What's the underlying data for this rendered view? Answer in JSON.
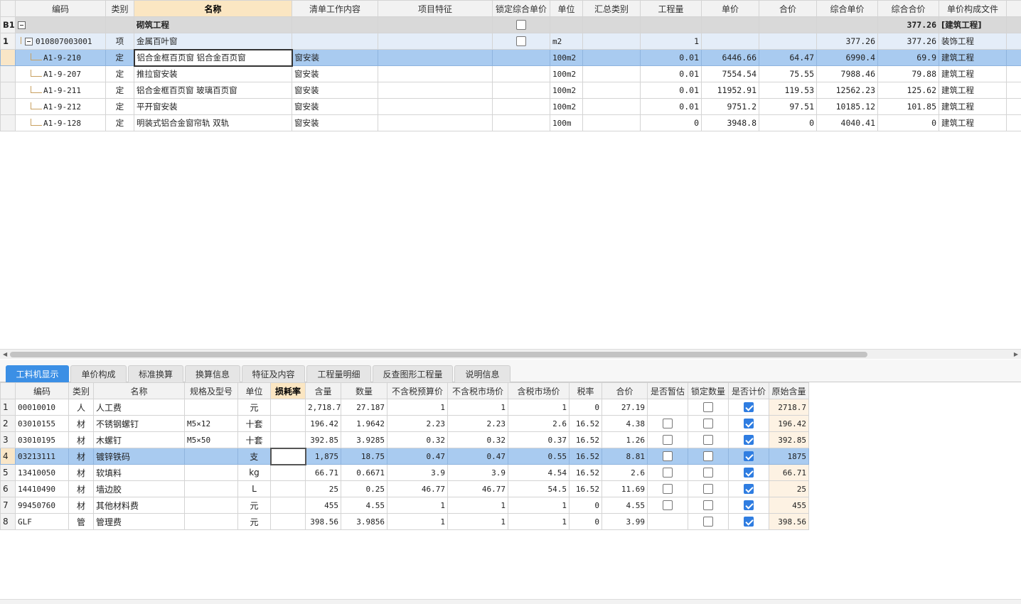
{
  "top": {
    "headers": [
      "",
      "编码",
      "类别",
      "名称",
      "清单工作内容",
      "项目特征",
      "锁定综合单价",
      "单位",
      "汇总类别",
      "工程量",
      "单价",
      "合价",
      "综合单价",
      "综合合价",
      "单价构成文件"
    ],
    "group": {
      "rn": "B1",
      "name": "砌筑工程",
      "total": "377.26",
      "file": "[建筑工程]"
    },
    "item": {
      "rn": "1",
      "code": "010807003001",
      "type": "项",
      "name": "金属百叶窗",
      "unit": "m2",
      "qty": "1",
      "comp_price": "377.26",
      "comp_total": "377.26",
      "file": "装饰工程"
    },
    "rows": [
      {
        "code": "A1-9-210",
        "type": "定",
        "name": "铝合金框百页窗 铝合金百页窗",
        "work": "窗安装",
        "unit": "100m2",
        "qty": "0.01",
        "price": "6446.66",
        "total": "64.47",
        "comp_price": "6990.4",
        "comp_total": "69.9",
        "file": "建筑工程"
      },
      {
        "code": "A1-9-207",
        "type": "定",
        "name": "推拉窗安装",
        "work": "窗安装",
        "unit": "100m2",
        "qty": "0.01",
        "price": "7554.54",
        "total": "75.55",
        "comp_price": "7988.46",
        "comp_total": "79.88",
        "file": "建筑工程"
      },
      {
        "code": "A1-9-211",
        "type": "定",
        "name": "铝合金框百页窗 玻璃百页窗",
        "work": "窗安装",
        "unit": "100m2",
        "qty": "0.01",
        "price": "11952.91",
        "total": "119.53",
        "comp_price": "12562.23",
        "comp_total": "125.62",
        "file": "建筑工程"
      },
      {
        "code": "A1-9-212",
        "type": "定",
        "name": "平开窗安装",
        "work": "窗安装",
        "unit": "100m2",
        "qty": "0.01",
        "price": "9751.2",
        "total": "97.51",
        "comp_price": "10185.12",
        "comp_total": "101.85",
        "file": "建筑工程"
      },
      {
        "code": "A1-9-128",
        "type": "定",
        "name": "明装式铝合金窗帘轨 双轨",
        "work": "窗安装",
        "unit": "100m",
        "qty": "0",
        "price": "3948.8",
        "total": "0",
        "comp_price": "4040.41",
        "comp_total": "0",
        "file": "建筑工程"
      }
    ]
  },
  "tabs": [
    "工料机显示",
    "单价构成",
    "标准换算",
    "换算信息",
    "特征及内容",
    "工程量明细",
    "反查图形工程量",
    "说明信息"
  ],
  "bottom": {
    "headers": [
      "",
      "编码",
      "类别",
      "名称",
      "规格及型号",
      "单位",
      "损耗率",
      "含量",
      "数量",
      "不含税预算价",
      "不含税市场价",
      "含税市场价",
      "税率",
      "合价",
      "是否暂估",
      "锁定数量",
      "是否计价",
      "原始含量"
    ],
    "rows": [
      {
        "rn": "1",
        "code": "00010010",
        "type": "人",
        "name": "人工费",
        "spec": "",
        "unit": "元",
        "content": "2,718.7",
        "qty": "27.187",
        "budget": "1",
        "market": "1",
        "market_tax": "1",
        "tax": "0",
        "total": "27.19",
        "est": null,
        "lock": false,
        "priced": true,
        "orig": "2718.7"
      },
      {
        "rn": "2",
        "code": "03010155",
        "type": "材",
        "name": "不锈钢螺钉",
        "spec": "M5×12",
        "unit": "十套",
        "content": "196.42",
        "qty": "1.9642",
        "budget": "2.23",
        "market": "2.23",
        "market_tax": "2.6",
        "tax": "16.52",
        "total": "4.38",
        "est": false,
        "lock": false,
        "priced": true,
        "orig": "196.42"
      },
      {
        "rn": "3",
        "code": "03010195",
        "type": "材",
        "name": "木螺钉",
        "spec": "M5×50",
        "unit": "十套",
        "content": "392.85",
        "qty": "3.9285",
        "budget": "0.32",
        "market": "0.32",
        "market_tax": "0.37",
        "tax": "16.52",
        "total": "1.26",
        "est": false,
        "lock": false,
        "priced": true,
        "orig": "392.85"
      },
      {
        "rn": "4",
        "code": "03213111",
        "type": "材",
        "name": "镀锌铁码",
        "spec": "",
        "unit": "支",
        "content": "1,875",
        "qty": "18.75",
        "budget": "0.47",
        "market": "0.47",
        "market_tax": "0.55",
        "tax": "16.52",
        "total": "8.81",
        "est": false,
        "lock": false,
        "priced": true,
        "orig": "1875"
      },
      {
        "rn": "5",
        "code": "13410050",
        "type": "材",
        "name": "软填料",
        "spec": "",
        "unit": "kg",
        "content": "66.71",
        "qty": "0.6671",
        "budget": "3.9",
        "market": "3.9",
        "market_tax": "4.54",
        "tax": "16.52",
        "total": "2.6",
        "est": false,
        "lock": false,
        "priced": true,
        "orig": "66.71"
      },
      {
        "rn": "6",
        "code": "14410490",
        "type": "材",
        "name": "墙边胶",
        "spec": "",
        "unit": "L",
        "content": "25",
        "qty": "0.25",
        "budget": "46.77",
        "market": "46.77",
        "market_tax": "54.5",
        "tax": "16.52",
        "total": "11.69",
        "est": false,
        "lock": false,
        "priced": true,
        "orig": "25"
      },
      {
        "rn": "7",
        "code": "99450760",
        "type": "材",
        "name": "其他材料费",
        "spec": "",
        "unit": "元",
        "content": "455",
        "qty": "4.55",
        "budget": "1",
        "market": "1",
        "market_tax": "1",
        "tax": "0",
        "total": "4.55",
        "est": false,
        "lock": false,
        "priced": true,
        "orig": "455"
      },
      {
        "rn": "8",
        "code": "GLF",
        "type": "管",
        "name": "管理费",
        "spec": "",
        "unit": "元",
        "content": "398.56",
        "qty": "3.9856",
        "budget": "1",
        "market": "1",
        "market_tax": "1",
        "tax": "0",
        "total": "3.99",
        "est": null,
        "lock": false,
        "priced": true,
        "orig": "398.56"
      }
    ]
  },
  "colors": {
    "selected_row": "#a9cbf0",
    "header_highlight": "#fbe6c2",
    "active_tab": "#3b8fe5",
    "checkbox_checked": "#2f7de1"
  },
  "icons": [
    "collapse-icon",
    "checkbox-icon",
    "scroll-left-icon",
    "scroll-right-icon"
  ]
}
